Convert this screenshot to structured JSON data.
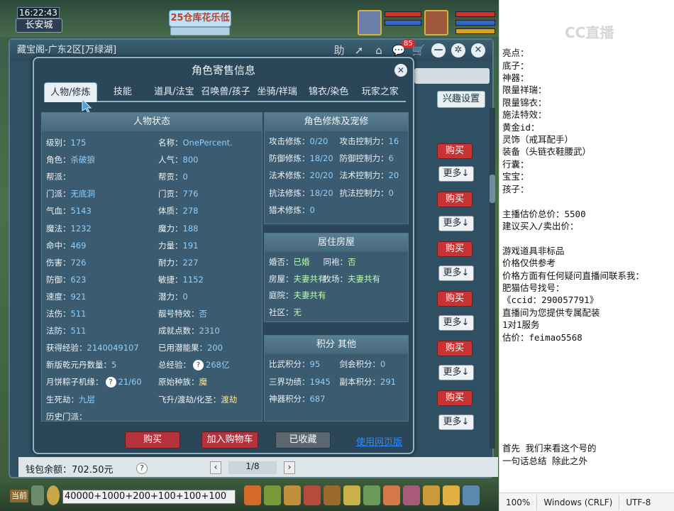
{
  "game": {
    "clock": "16:22:43",
    "city": "长安城",
    "banner": "25仓库花乐低",
    "window_title": "藏宝阁-广东2区[万绿湖]",
    "title_icons": {
      "help": "助",
      "share": "➚",
      "home": "⌂",
      "chat_badge": "85",
      "cart": "🛒"
    },
    "interest_button": "兴趣设置",
    "side_buy": "购买",
    "side_more": "更多↓",
    "wallet_label": "钱包余额：702.50元",
    "wallet_help": "?",
    "pager": {
      "prev": "‹",
      "page": "1/8",
      "next": "›"
    },
    "chat_input": "40000+1000+200+100+100+100",
    "chat_button": "当前"
  },
  "dialog": {
    "title": "角色寄售信息",
    "close": "✕",
    "tabs": [
      "人物/修炼",
      "技能",
      "道具/法宝",
      "召唤兽/孩子",
      "坐骑/祥瑞",
      "锦衣/染色",
      "玩家之家"
    ],
    "status_panel": {
      "header": "人物状态",
      "left": [
        {
          "k": "级别：",
          "v": "175"
        },
        {
          "k": "角色：",
          "v": "杀破狼"
        },
        {
          "k": "帮派：",
          "v": ""
        },
        {
          "k": "门派：",
          "v": "无底洞"
        },
        {
          "k": "气血：",
          "v": "5143"
        },
        {
          "k": "魔法：",
          "v": "1232"
        },
        {
          "k": "命中：",
          "v": "469"
        },
        {
          "k": "伤害：",
          "v": "726"
        },
        {
          "k": "防御：",
          "v": "623"
        },
        {
          "k": "速度：",
          "v": "921"
        },
        {
          "k": "法伤：",
          "v": "511"
        },
        {
          "k": "法防：",
          "v": "511"
        },
        {
          "k": "获得经验：",
          "v": "2140049107"
        },
        {
          "k": "新版乾元丹数量：",
          "v": "5"
        },
        {
          "k": "月饼粽子机缘：",
          "v": "21/60",
          "q": "?"
        },
        {
          "k": "生死劫：",
          "v": "九层"
        },
        {
          "k": "历史门派：",
          "v": ""
        }
      ],
      "right": [
        {
          "k": "名称：",
          "v": "OnePercent."
        },
        {
          "k": "人气：",
          "v": "800"
        },
        {
          "k": "帮贡：",
          "v": "0"
        },
        {
          "k": "门贡：",
          "v": "776"
        },
        {
          "k": "体质：",
          "v": "278"
        },
        {
          "k": "魔力：",
          "v": "188"
        },
        {
          "k": "力量：",
          "v": "191"
        },
        {
          "k": "耐力：",
          "v": "227"
        },
        {
          "k": "敏捷：",
          "v": "1152"
        },
        {
          "k": "潜力：",
          "v": "0"
        },
        {
          "k": "靓号特效：",
          "v": "否"
        },
        {
          "k": "成就点数：",
          "v": "2310"
        },
        {
          "k": "已用潜能果：",
          "v": "200"
        },
        {
          "k": "总经验：",
          "v": "268亿",
          "q": "?"
        },
        {
          "k": "原始种族：",
          "v": "魔"
        },
        {
          "k": "飞升/渡劫/化圣：",
          "v": "渡劫"
        }
      ]
    },
    "cultivation_panel": {
      "header": "角色修炼及宠修",
      "rows": [
        {
          "k1": "攻击修炼：",
          "v1": "0/20",
          "k2": "攻击控制力：",
          "v2": "16"
        },
        {
          "k1": "防御修炼：",
          "v1": "18/20",
          "k2": "防御控制力：",
          "v2": "6"
        },
        {
          "k1": "法术修炼：",
          "v1": "20/20",
          "k2": "法术控制力：",
          "v2": "20"
        },
        {
          "k1": "抗法修炼：",
          "v1": "18/20",
          "k2": "抗法控制力：",
          "v2": "0"
        },
        {
          "k1": "猎术修炼：",
          "v1": "0",
          "k2": "",
          "v2": ""
        }
      ]
    },
    "house_panel": {
      "header": "居住房屋",
      "rows": [
        {
          "k1": "婚否：",
          "v1": "已婚",
          "k2": "同袍：",
          "v2": "否"
        },
        {
          "k1": "房屋：",
          "v1": "夫妻共有",
          "k2": "牧场：",
          "v2": "夫妻共有"
        },
        {
          "k1": "庭院：",
          "v1": "夫妻共有",
          "k2": "",
          "v2": ""
        },
        {
          "k1": "社区：",
          "v1": "无",
          "k2": "",
          "v2": ""
        }
      ]
    },
    "points_panel": {
      "header": "积分 其他",
      "rows": [
        {
          "k1": "比武积分：",
          "v1": "95",
          "k2": "剑会积分：",
          "v2": "0"
        },
        {
          "k1": "三界功绩：",
          "v1": "1945",
          "k2": "副本积分：",
          "v2": "291"
        },
        {
          "k1": "神器积分：",
          "v1": "687",
          "k2": "",
          "v2": ""
        }
      ]
    },
    "buttons": {
      "buy": "购买",
      "add_cart": "加入购物车",
      "favorited": "已收藏",
      "web_version": "使用网页版"
    }
  },
  "notes": {
    "watermark": "CC直播",
    "text": "亮点：\n底子：\n神器：\n限量祥瑞：\n限量锦衣：\n施法特效：\n黄金id：\n灵饰（戒耳配手）\n装备（头链衣鞋腰武）\n行囊：\n宝宝：\n孩子：\n\n主播估价总价：5500\n建议买入/卖出价：\n\n游戏道具非标品\n价格仅供参考\n价格方面有任何疑问直播间联系我：\n肥猫估号找号：\n《ccid：290057791》\n直播间为您提供专属配装\n1对1服务\n估价：feimao5568\n\n\n\n\n\n\n\n\n首先 我们来看这个号的\n一句话总结 除此之外",
    "status": [
      "100%",
      "Windows (CRLF)",
      "UTF-8"
    ]
  }
}
